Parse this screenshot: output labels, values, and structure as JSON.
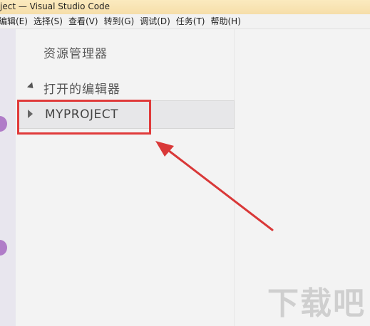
{
  "titlebar": {
    "title": "ject — Visual Studio Code"
  },
  "menubar": {
    "items": [
      "编辑(E)",
      "选择(S)",
      "查看(V)",
      "转到(G)",
      "调试(D)",
      "任务(T)",
      "帮助(H)"
    ]
  },
  "sidebar": {
    "title": "资源管理器",
    "section_label": "打开的编辑器",
    "project_label": "MYPROJECT"
  },
  "watermark": {
    "text": "下载吧"
  },
  "colors": {
    "highlight": "#e03a3a",
    "arrow": "#d93838"
  },
  "icons": [
    "collapse-triangle-icon",
    "expand-triangle-icon"
  ]
}
